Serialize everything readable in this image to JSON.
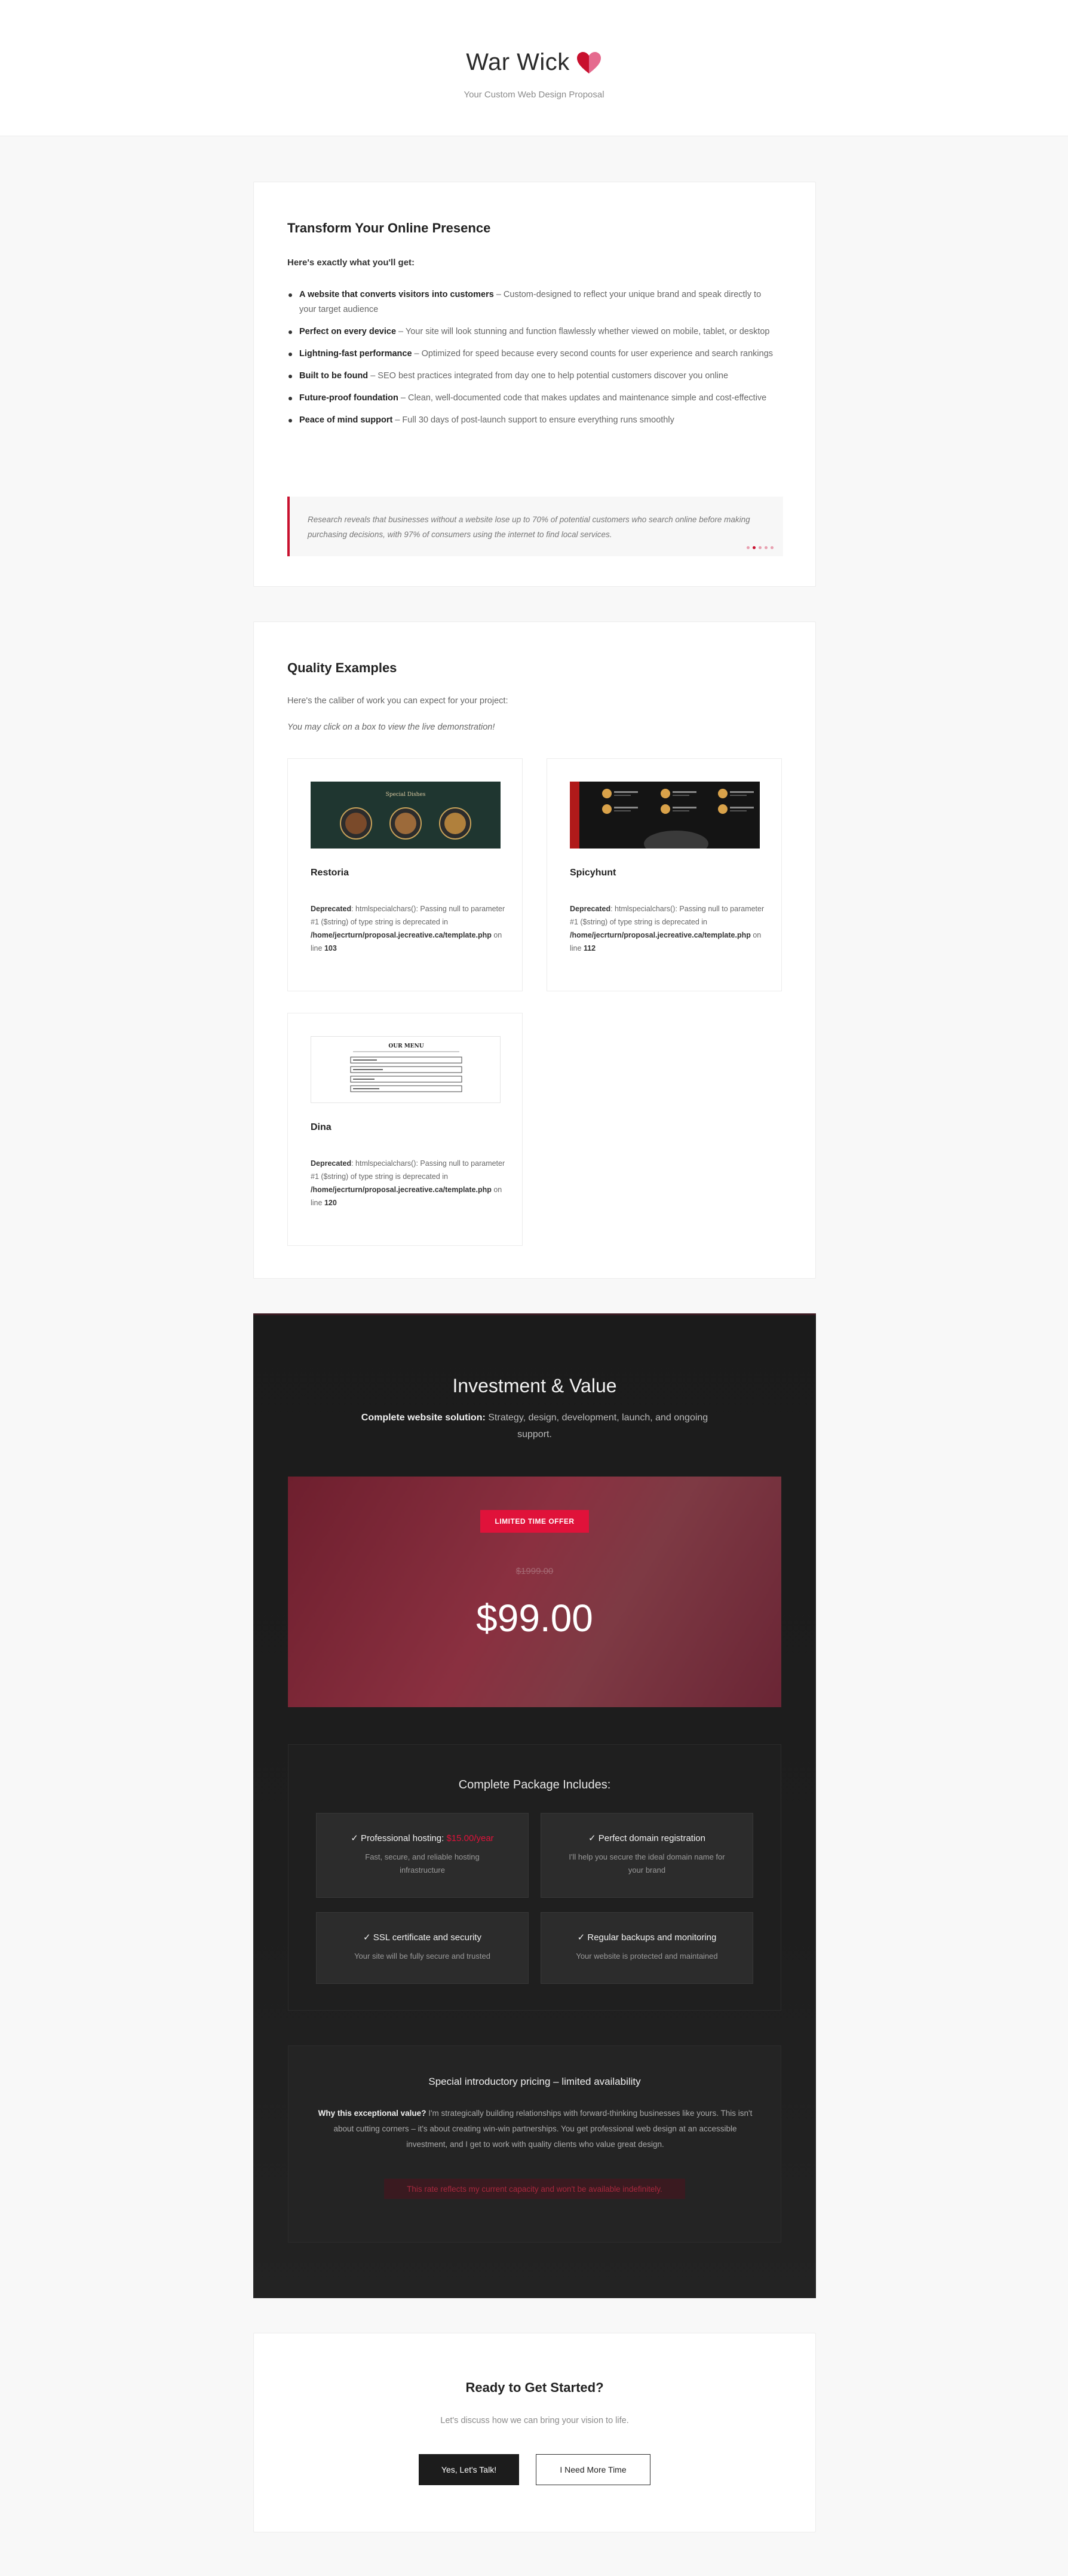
{
  "header": {
    "brand": "War Wick",
    "tagline": "Your Custom Web Design Proposal",
    "brand_colors": [
      "#c8102e",
      "#e56a8e"
    ]
  },
  "transform": {
    "title": "Transform Your Online Presence",
    "intro": "Here's exactly what you'll get:",
    "features": [
      {
        "title": "A website that converts visitors into customers",
        "text": " – Custom-designed to reflect your unique brand and speak directly to your target audience"
      },
      {
        "title": "Perfect on every device",
        "text": " – Your site will look stunning and function flawlessly whether viewed on mobile, tablet, or desktop"
      },
      {
        "title": "Lightning-fast performance",
        "text": " – Optimized for speed because every second counts for user experience and search rankings"
      },
      {
        "title": "Built to be found",
        "text": " – SEO best practices integrated from day one to help potential customers discover you online"
      },
      {
        "title": "Future-proof foundation",
        "text": " – Clean, well-documented code that makes updates and maintenance simple and cost-effective"
      },
      {
        "title": "Peace of mind support",
        "text": " – Full 30 days of post-launch support to ensure everything runs smoothly"
      }
    ],
    "quote": "Research reveals that businesses without a website lose up to 70% of potential customers who search online before making purchasing decisions, with 97% of consumers using the internet to find local services.",
    "accent_color": "#c8102e"
  },
  "examples": {
    "title": "Quality Examples",
    "caption": "Here's the caliber of work you can expect for your project:",
    "hint": "You may click on a box to view the live demonstration!",
    "items": [
      {
        "name": "Restoria",
        "error_label": "Deprecated",
        "error_text": ": htmlspecialchars(): Passing null to parameter #1 ($string) of type string is deprecated in ",
        "error_path": "/home/jecrturn/proposal.jecreative.ca/template.php",
        "error_line_prefix": " on line ",
        "error_line": "103",
        "thumb_text": "Special Dishes"
      },
      {
        "name": "Spicyhunt",
        "error_label": "Deprecated",
        "error_text": ": htmlspecialchars(): Passing null to parameter #1 ($string) of type string is deprecated in ",
        "error_path": "/home/jecrturn/proposal.jecreative.ca/template.php",
        "error_line_prefix": " on line ",
        "error_line": "112"
      },
      {
        "name": "Dina",
        "error_label": "Deprecated",
        "error_text": ": htmlspecialchars(): Passing null to parameter #1 ($string) of type string is deprecated in ",
        "error_path": "/home/jecrturn/proposal.jecreative.ca/template.php",
        "error_line_prefix": " on line ",
        "error_line": "120",
        "thumb_text": "OUR MENU"
      }
    ]
  },
  "investment": {
    "title": "Investment & Value",
    "subtitle_bold": "Complete website solution:",
    "subtitle_rest": " Strategy, design, development, launch, and ongoing support.",
    "badge": "LIMITED TIME OFFER",
    "old_price": "$1999.00",
    "price": "$99.00",
    "package_title": "Complete Package Includes:",
    "package_items": [
      {
        "head": "✓ Professional hosting: ",
        "highlight": "$15.00/year",
        "desc": "Fast, secure, and reliable hosting infrastructure"
      },
      {
        "head": "✓ Perfect domain registration",
        "highlight": "",
        "desc": "I'll help you secure the ideal domain name for your brand"
      },
      {
        "head": "✓ SSL certificate and security",
        "highlight": "",
        "desc": "Your site will be fully secure and trusted"
      },
      {
        "head": "✓ Regular backups and monitoring",
        "highlight": "",
        "desc": "Your website is protected and maintained"
      }
    ],
    "special_title": "Special introductory pricing – limited availability",
    "special_bold": "Why this exceptional value?",
    "special_body": " I'm strategically building relationships with forward-thinking businesses like yours. This isn't about cutting corners – it's about creating win-win partnerships. You get professional web design at an accessible investment, and I get to work with quality clients who value great design.",
    "warning": "This rate reflects my current capacity and won't be available indefinitely.",
    "accent_color": "#e0123a"
  },
  "ready": {
    "title": "Ready to Get Started?",
    "subtitle": "Let's discuss how we can bring your vision to life.",
    "primary_button": "Yes, Let's Talk!",
    "secondary_button": "I Need More Time"
  }
}
